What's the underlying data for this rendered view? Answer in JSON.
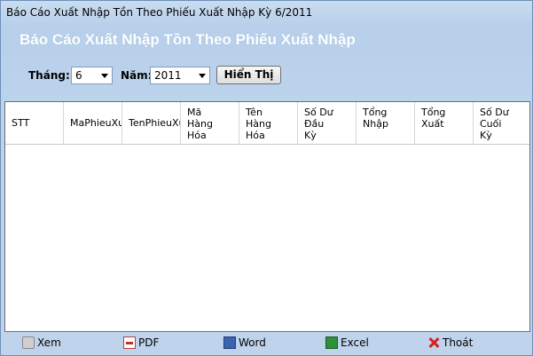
{
  "window": {
    "title": "Báo Cáo Xuất Nhập Tồn Theo Phiếu Xuất Nhập Kỳ 6/2011",
    "heading": "Báo Cáo Xuất Nhập Tồn Theo Phiếu Xuất Nhập"
  },
  "filters": {
    "month_label": "Tháng:",
    "month_value": "6",
    "year_label": "Năm:",
    "year_value": "2011",
    "show_button": "Hiển Thị"
  },
  "grid": {
    "columns": [
      "STT",
      "MaPhieuXuất",
      "TenPhieuXuất",
      "Mã\nHàng\nHóa",
      "Tên\nHàng\nHóa",
      "Số Dư\nĐầu\nKỳ",
      "Tổng\nNhập",
      "Tổng\nXuất",
      "Số Dư\nCuối\nKỳ"
    ],
    "rows": []
  },
  "toolbar": {
    "print": "Xem",
    "pdf": "PDF",
    "word": "Word",
    "excel": "Excel",
    "exit": "Thoát"
  },
  "icons": {
    "print": "printer-icon",
    "pdf": "pdf-icon",
    "word": "word-icon",
    "excel": "excel-icon",
    "exit": "close-icon"
  }
}
